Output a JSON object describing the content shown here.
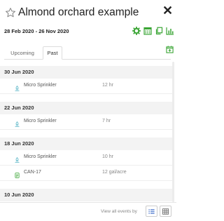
{
  "header": {
    "title": "Almond orchard example",
    "date_range": "28 Feb 2020 - 26 Nov 2020",
    "close_label": "✕",
    "icons": [
      "star-icon",
      "gear-icon",
      "calendar-grid-icon",
      "copy-icon",
      "bar-chart-icon"
    ],
    "accent_color": "#3aa535"
  },
  "tabs": [
    {
      "label": "Upcoming",
      "active": false
    },
    {
      "label": "Past",
      "active": true
    }
  ],
  "events": {
    "groups": [
      {
        "date": "30 Jun 2020",
        "items": [
          {
            "name": "Micro Sprinkler",
            "amount": "12 hr",
            "icon": "irrigation-icon"
          }
        ]
      },
      {
        "date": "22 Jun 2020",
        "items": [
          {
            "name": "Micro Sprinkler",
            "amount": "7 hr",
            "icon": "irrigation-icon"
          }
        ]
      },
      {
        "date": "18 Jun 2020",
        "items": [
          {
            "name": "Micro Sprinkler",
            "amount": "10 hr",
            "icon": "irrigation-icon"
          },
          {
            "name": "CAN-17",
            "amount": "12 gal/acre",
            "icon": "fertilizer-icon"
          }
        ]
      },
      {
        "date": "10 Jun 2020",
        "items": []
      }
    ]
  },
  "footer": {
    "view_label": "View all events by"
  }
}
